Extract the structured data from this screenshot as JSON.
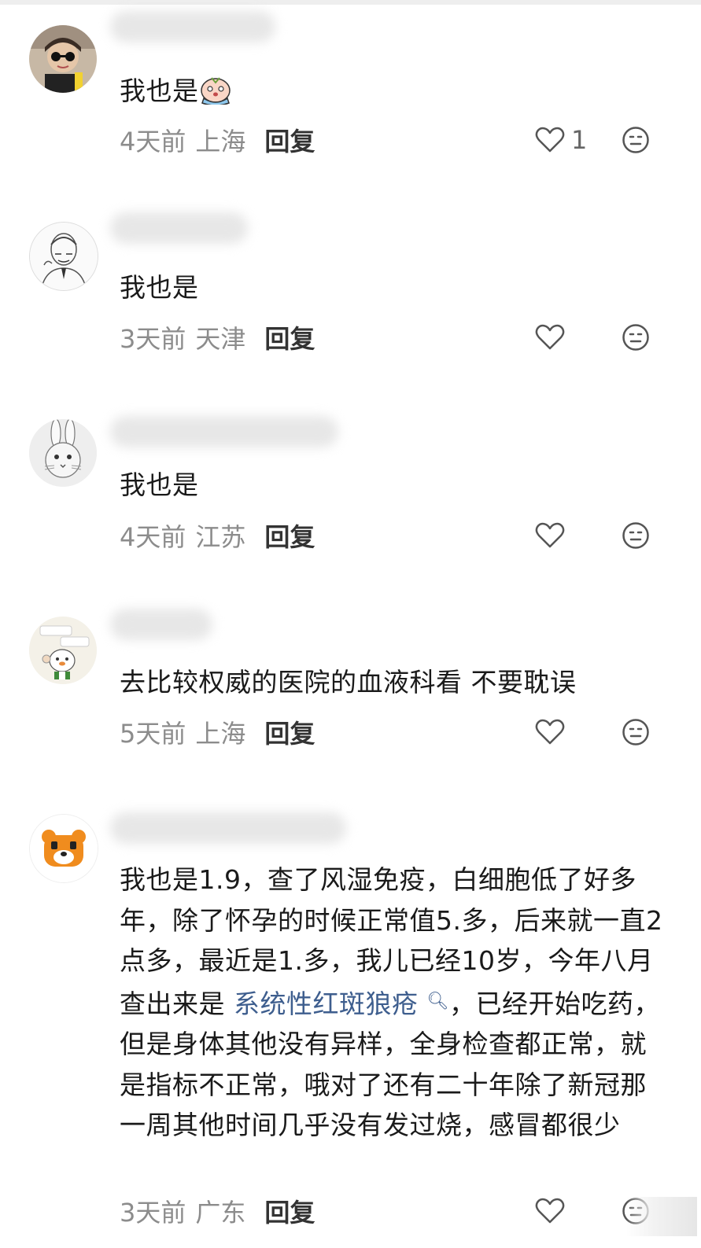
{
  "comments": [
    {
      "avatar_icon": "avatar-child-sunglasses",
      "text": "我也是",
      "emoji": "crying-face-sticker",
      "time": "4天前",
      "location": "上海",
      "reply": "回复",
      "likes": "1"
    },
    {
      "avatar_icon": "avatar-sketch-man",
      "text": "我也是",
      "time": "3天前",
      "location": "天津",
      "reply": "回复",
      "likes": ""
    },
    {
      "avatar_icon": "avatar-rabbit-sketch",
      "text": "我也是",
      "time": "4天前",
      "location": "江苏",
      "reply": "回复",
      "likes": ""
    },
    {
      "avatar_icon": "avatar-cartoon-sticker",
      "text": "去比较权威的医院的血液科看 不要耽误",
      "time": "5天前",
      "location": "上海",
      "reply": "回复",
      "likes": ""
    },
    {
      "avatar_icon": "avatar-orange-bear",
      "text_before": "我也是1.9，查了风湿免疫，白细胞低了好多年，除了怀孕的时候正常值5.多，后来就一直2点多，最近是1.多，我儿已经10岁，今年八月查出来是",
      "link_text": "系统性红斑狼疮",
      "text_after": "，已经开始吃药，但是身体其他没有异样，全身检查都正常，就是指标不正常，哦对了还有二十年除了新冠那一周其他时间几乎没有发过烧，感冒都很少",
      "time": "3天前",
      "location": "广东",
      "reply": "回复",
      "likes": ""
    }
  ],
  "icons": {
    "like": "heart-outline-icon",
    "emoji": "neutral-face-icon",
    "search": "search-icon"
  },
  "colors": {
    "text": "#1a1a1a",
    "meta": "#8c8c8c",
    "link": "#3e5e8e",
    "icon": "#555555"
  }
}
